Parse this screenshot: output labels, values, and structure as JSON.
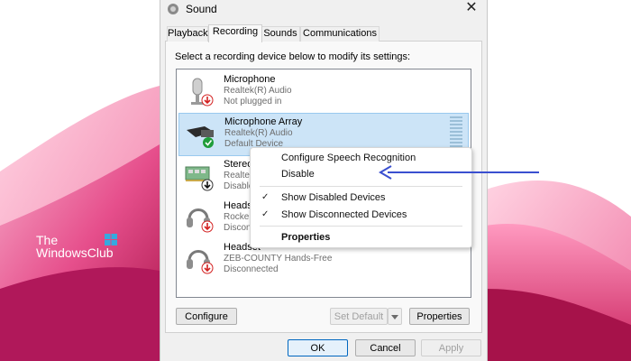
{
  "brand": {
    "line1": "The",
    "line2": "WindowsClub"
  },
  "window": {
    "title": "Sound",
    "close_glyph": "✕"
  },
  "tabs": [
    {
      "label": "Playback"
    },
    {
      "label": "Recording"
    },
    {
      "label": "Sounds"
    },
    {
      "label": "Communications"
    }
  ],
  "active_tab": "Recording",
  "instruction": "Select a recording device below to modify its settings:",
  "devices": [
    {
      "name": "Microphone",
      "driver": "Realtek(R) Audio",
      "status": "Not plugged in",
      "icon": "microphone-icon",
      "badge": "red-down-arrow-badge"
    },
    {
      "name": "Microphone Array",
      "driver": "Realtek(R) Audio",
      "status": "Default Device",
      "icon": "microphone-array-icon",
      "badge": "green-check-badge"
    },
    {
      "name": "Stereo",
      "driver": "Realtek",
      "status": "Disable",
      "icon": "sound-card-icon",
      "badge": "black-down-arrow-badge"
    },
    {
      "name": "Headset",
      "driver": "Rocker",
      "status": "Disconn",
      "icon": "headset-icon",
      "badge": "red-down-arrow-badge"
    },
    {
      "name": "Headset",
      "driver": "ZEB-COUNTY Hands-Free",
      "status": "Disconnected",
      "icon": "headset-icon",
      "badge": "red-down-arrow-badge"
    }
  ],
  "context_menu": {
    "items": [
      {
        "label": "Configure Speech Recognition",
        "checked": false
      },
      {
        "label": "Disable",
        "checked": false
      },
      {
        "label": "Show Disabled Devices",
        "checked": true
      },
      {
        "label": "Show Disconnected Devices",
        "checked": true
      },
      {
        "label": "Properties",
        "checked": false,
        "bold": true
      }
    ],
    "check_glyph": "✓"
  },
  "buttons": {
    "configure": "Configure",
    "set_default": "Set Default",
    "properties": "Properties",
    "ok": "OK",
    "cancel": "Cancel",
    "apply": "Apply"
  },
  "colors": {
    "selection": "#cce4f7",
    "arrow": "#3a4fd0",
    "accent": "#0067c0"
  }
}
